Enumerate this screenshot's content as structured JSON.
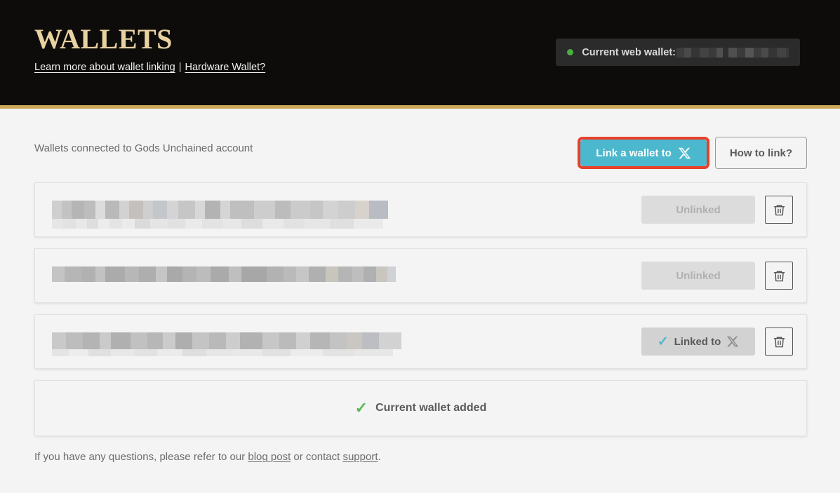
{
  "header": {
    "title": "WALLETS",
    "links": [
      {
        "label": "Learn more about wallet linking",
        "name": "learn-more-link"
      },
      {
        "label": "Hardware Wallet?",
        "name": "hardware-wallet-link"
      }
    ],
    "separator": "|",
    "status_pill": {
      "dot_color": "#4caf3f",
      "label": "Current web wallet:",
      "value_redacted": true
    },
    "background_color": "#0d0c0a",
    "title_color": "#e8d2a2",
    "rule_color": "#cba85a"
  },
  "main": {
    "subheading": "Wallets connected to Gods Unchained account",
    "actions": {
      "link_wallet": {
        "label": "Link a wallet to",
        "icon": "x-logo-icon",
        "background": "#4cb8cd",
        "highlight_border": "#e8402a"
      },
      "how_to_link": {
        "label": "How to link?"
      }
    },
    "wallet_rows": [
      {
        "address_redacted": true,
        "status_label": "Unlinked",
        "status": "unlinked",
        "delete_icon": "trash-icon"
      },
      {
        "address_redacted": true,
        "status_label": "Unlinked",
        "status": "unlinked",
        "delete_icon": "trash-icon"
      },
      {
        "address_redacted": true,
        "status_label": "Linked to",
        "status": "linked",
        "status_icon": "check-icon",
        "status_trailing_icon": "x-logo-icon",
        "delete_icon": "trash-icon"
      }
    ],
    "current_wallet_row": {
      "icon": "check-icon",
      "label": "Current wallet added",
      "icon_color": "#5cb85c"
    },
    "footer": {
      "text_before": "If you have any questions, please refer to our ",
      "link_blog": "blog post",
      "text_middle": " or contact ",
      "link_support": "support",
      "text_after": "."
    }
  }
}
